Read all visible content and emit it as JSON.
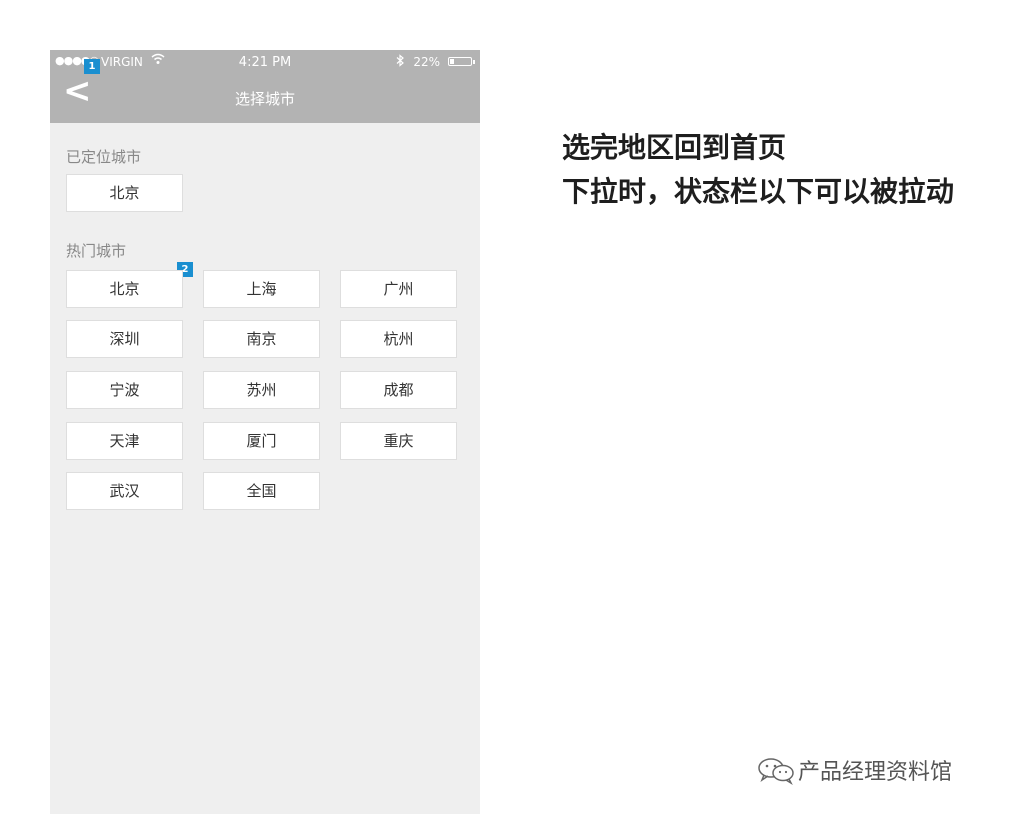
{
  "status_bar": {
    "signal": "●●●●○",
    "carrier": "VIRGIN",
    "time": "4:21 PM",
    "battery": "22%",
    "battery_level": 0.22
  },
  "nav": {
    "back_label": "<",
    "title": "选择城市"
  },
  "markers": [
    "1",
    "2"
  ],
  "located": {
    "label": "已定位城市",
    "city": "北京"
  },
  "hot": {
    "label": "热门城市",
    "cities": [
      "北京",
      "上海",
      "广州",
      "深圳",
      "南京",
      "杭州",
      "宁波",
      "苏州",
      "成都",
      "天津",
      "厦门",
      "重庆",
      "武汉",
      "全国"
    ]
  },
  "note": {
    "line1": "选完地区回到首页",
    "line2": "下拉时，状态栏以下可以被拉动"
  },
  "watermark": "产品经理资料馆",
  "colors": {
    "header": "#b3b3b3",
    "background": "#efefef",
    "marker": "#1a8fd0"
  },
  "icons": [
    "wifi-icon",
    "bluetooth-icon",
    "battery-icon",
    "back-arrow-icon",
    "wechat-icon"
  ]
}
